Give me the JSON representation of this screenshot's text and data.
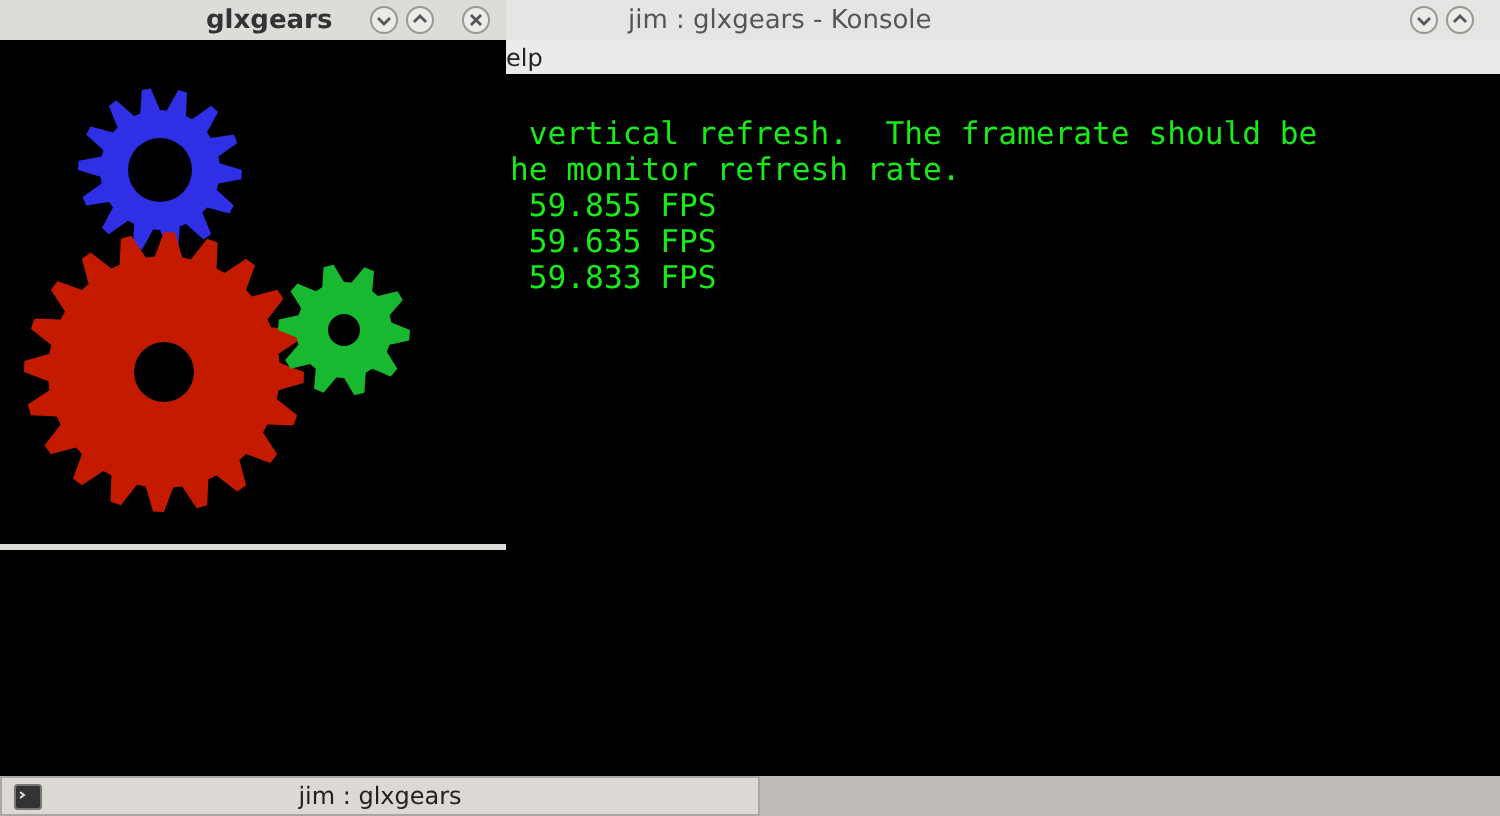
{
  "konsole": {
    "title": "jim : glxgears - Konsole",
    "menu": [
      "elp"
    ],
    "lines": [
      " vertical refresh.  The framerate should be",
      "he monitor refresh rate.",
      " 59.855 FPS",
      " 59.635 FPS",
      " 59.833 FPS"
    ]
  },
  "glxgears": {
    "title": "glxgears"
  },
  "taskbar": {
    "tasks": [
      {
        "label": "jim : glxgears"
      }
    ]
  }
}
